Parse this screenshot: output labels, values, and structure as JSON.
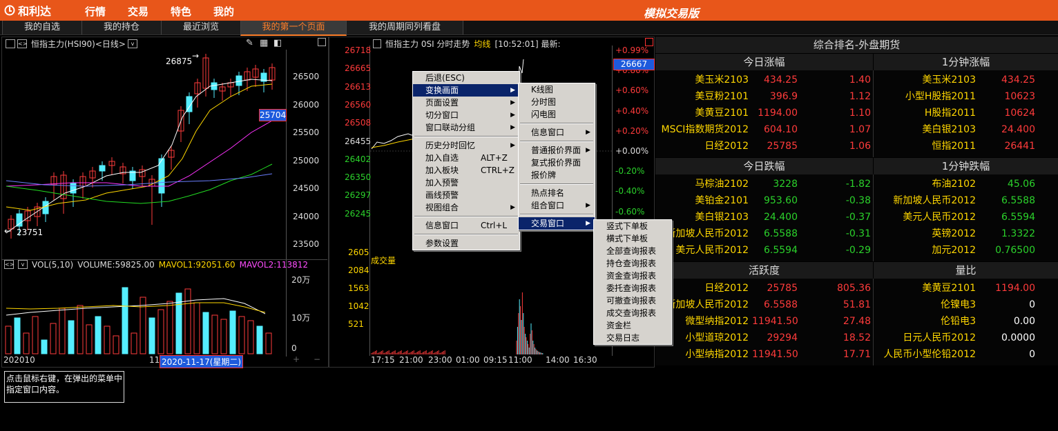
{
  "topbar": {
    "logo": "和利达",
    "nav": [
      "行情",
      "交易",
      "特色",
      "我的"
    ],
    "app_name": "模拟交易版",
    "accent": "#e8561a"
  },
  "tabs": [
    "我的自选",
    "我的持仓",
    "最近浏览",
    "我的第一个页面",
    "我的周期同列看盘"
  ],
  "kline": {
    "title": "恒指主力(HSI90)<日线>",
    "yticks": [
      "26500",
      "26000",
      "25500",
      "25000",
      "24500",
      "24000",
      "23500"
    ],
    "high_label": "26875",
    "low_label": "23751",
    "price_tag": "25704",
    "vol_title": "VOL(5,10)",
    "volume": "VOLUME:59825.00",
    "mavol1": "MAVOL1:92051.60",
    "mavol2": "MAVOL2:113812.2",
    "vticks": [
      "20万",
      "10万",
      "0"
    ],
    "date_left": "202010",
    "date_mid": "11",
    "date_sel": "2020-11-17(星期二)"
  },
  "intraday": {
    "title": "恒指主力 0SI 分时走势",
    "avg": "均线",
    "time": "[10:52:01] 最新:",
    "lprices": [
      "26718",
      "26665",
      "26613",
      "26560",
      "26508",
      "26455",
      "26402",
      "26350",
      "26297",
      "26245"
    ],
    "rpct": [
      "+0.99%",
      "+0.80%",
      "+0.60%",
      "+0.40%",
      "+0.20%",
      "+0.00%",
      "-0.20%",
      "-0.40%",
      "-0.60%"
    ],
    "price_tag": "26667",
    "vol_label": "成交量",
    "vticks": [
      "2605",
      "2084",
      "1563",
      "1042",
      "521"
    ],
    "xticks": [
      "17:15",
      "21:00",
      "23:00",
      "01:00",
      "09:15",
      "11:00",
      "14:00",
      "16:30"
    ]
  },
  "ranking": {
    "title": "综合排名-外盘期货",
    "sections": [
      {
        "title": "今日涨幅",
        "cols": 3,
        "rows": [
          [
            "美玉米2103",
            "434.25",
            "1.40"
          ],
          [
            "美豆粉2101",
            "396.9",
            "1.12"
          ],
          [
            "美黄豆2101",
            "1194.00",
            "1.10"
          ],
          [
            "MSCI指数期货2012",
            "604.10",
            "1.07"
          ],
          [
            "日经2012",
            "25785",
            "1.06"
          ]
        ]
      },
      {
        "title": "1分钟涨幅",
        "cols": 2,
        "rows": [
          [
            "美玉米2103",
            "434.25"
          ],
          [
            "小型H股指2011",
            "10623"
          ],
          [
            "H股指2011",
            "10624"
          ],
          [
            "美白银2103",
            "24.400"
          ],
          [
            "恒指2011",
            "26441"
          ]
        ]
      },
      {
        "title": "今日跌幅",
        "cols": 3,
        "rows": [
          [
            "马棕油2102",
            "3228",
            "-1.82"
          ],
          [
            "美铂金2101",
            "953.60",
            "-0.38"
          ],
          [
            "美白银2103",
            "24.400",
            "-0.37"
          ],
          [
            "新加坡人民币2012",
            "6.5588",
            "-0.31"
          ],
          [
            "美元人民币2012",
            "6.5594",
            "-0.29"
          ]
        ]
      },
      {
        "title": "1分钟跌幅",
        "cols": 2,
        "rows": [
          [
            "布油2102",
            "45.06"
          ],
          [
            "新加坡人民币2012",
            "6.5588"
          ],
          [
            "美元人民币2012",
            "6.5594"
          ],
          [
            "英镑2012",
            "1.3322"
          ],
          [
            "加元2012",
            "0.76500"
          ]
        ]
      },
      {
        "title": "活跃度",
        "cols": 3,
        "rows": [
          [
            "日经2012",
            "25785",
            "805.36"
          ],
          [
            "新加坡人民币2012",
            "6.5588",
            "51.81"
          ],
          [
            "微型纳指2012",
            "11941.50",
            "27.48"
          ],
          [
            "小型道琼2012",
            "29294",
            "18.52"
          ],
          [
            "小型纳指2012",
            "11941.50",
            "17.71"
          ]
        ]
      },
      {
        "title": "量比",
        "cols": 2,
        "rows": [
          [
            "美黄豆2101",
            "1194.00"
          ],
          [
            "伦镍电3",
            "0"
          ],
          [
            "伦铅电3",
            "0.00"
          ],
          [
            "日元人民币2012",
            "0.0000"
          ],
          [
            "人民币小型伦铅2012",
            "0"
          ]
        ]
      }
    ]
  },
  "menu1": [
    {
      "label": "后退(ESC)"
    },
    {
      "label": "变换画面",
      "arrow": true,
      "sel": true
    },
    {
      "label": "页面设置",
      "arrow": true
    },
    {
      "label": "切分窗口",
      "arrow": true
    },
    {
      "label": "窗口联动分组",
      "arrow": true
    },
    {
      "sep": true
    },
    {
      "label": "历史分时回忆",
      "arrow": true
    },
    {
      "label": "加入自选",
      "sc": "ALT+Z"
    },
    {
      "label": "加入板块",
      "sc": "CTRL+Z"
    },
    {
      "label": "加入预警"
    },
    {
      "label": "画线预警"
    },
    {
      "label": "视图组合",
      "arrow": true
    },
    {
      "sep": true
    },
    {
      "label": "信息窗口",
      "sc": "Ctrl+L"
    },
    {
      "sep": true
    },
    {
      "label": "参数设置"
    }
  ],
  "menu2": [
    {
      "label": "K线图"
    },
    {
      "label": "分时图"
    },
    {
      "label": "闪电图"
    },
    {
      "sep": true
    },
    {
      "label": "信息窗口",
      "arrow": true
    },
    {
      "sep": true
    },
    {
      "label": "普通报价界面",
      "arrow": true
    },
    {
      "label": "复式报价界面"
    },
    {
      "label": "报价牌"
    },
    {
      "sep": true
    },
    {
      "label": "热点排名"
    },
    {
      "label": "组合窗口",
      "arrow": true
    },
    {
      "sep": true
    },
    {
      "label": "交易窗口",
      "arrow": true,
      "sel": true
    }
  ],
  "menu3": [
    {
      "label": "竖式下单板"
    },
    {
      "label": "横式下单板"
    },
    {
      "label": "全部查询报表"
    },
    {
      "label": "持仓查询报表"
    },
    {
      "label": "资金查询报表"
    },
    {
      "label": "委托查询报表"
    },
    {
      "label": "可撤查询报表"
    },
    {
      "label": "成交查询报表"
    },
    {
      "label": "资金栏"
    },
    {
      "label": "交易日志"
    }
  ],
  "hint": "点击鼠标右键，在弹出的菜单中指定窗口内容。"
}
